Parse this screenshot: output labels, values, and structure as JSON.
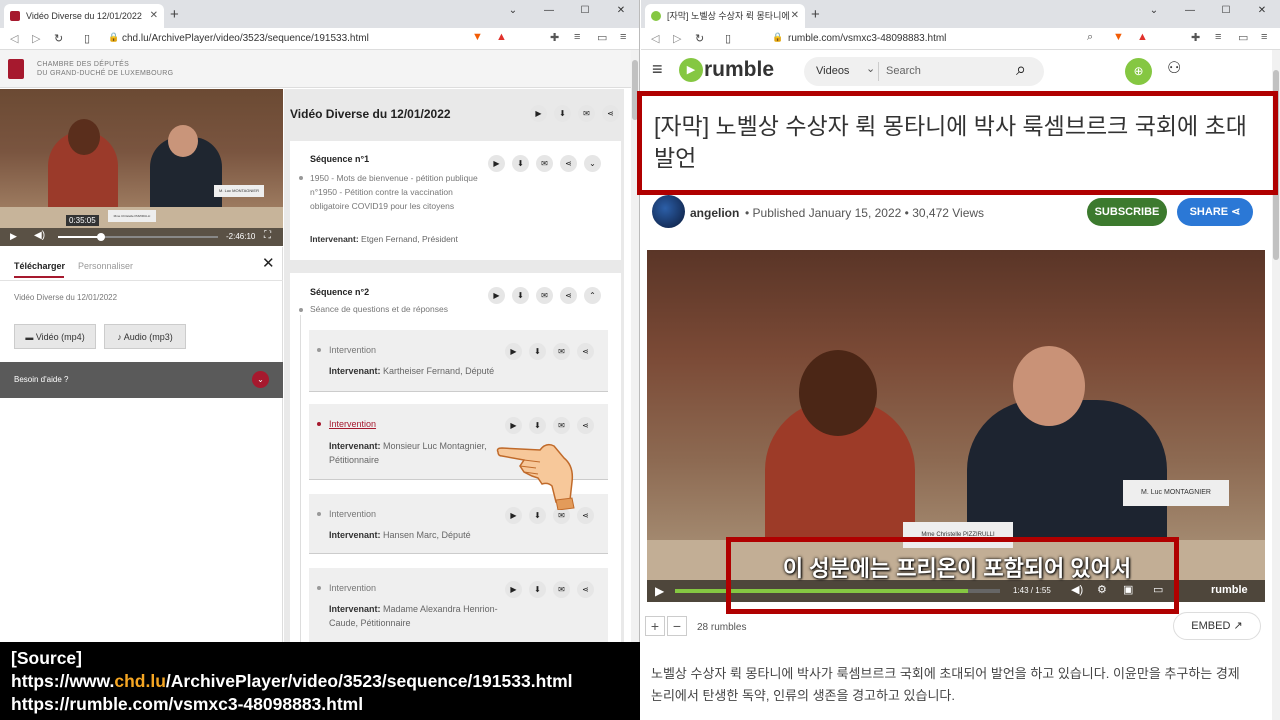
{
  "left_browser": {
    "tab_title": "Vidéo Diverse du 12/01/2022",
    "url": "chd.lu/ArchivePlayer/video/3523/sequence/191533.html",
    "site_header_line1": "CHAMBRE DES DÉPUTÉS",
    "site_header_line2": "DU GRAND-DUCHÉ DE LUXEMBOURG",
    "player": {
      "tooltip_time": "0:35:05",
      "remaining": "-2:46:10",
      "progress_fraction": 0.27,
      "nameplate_1": "Mme Christelle PIZZIRULLI",
      "nameplate_2": "M. Luc MONTAGNIER"
    },
    "download_panel": {
      "tab_active": "Télécharger",
      "tab_inactive": "Personnaliser",
      "video_name": "Vidéo Diverse du 12/01/2022",
      "btn_video": "Vidéo (mp4)",
      "btn_audio": "Audio (mp3)",
      "help": "Besoin d'aide ?"
    },
    "list_title": "Vidéo Diverse du 12/01/2022",
    "sequences": [
      {
        "title": "Séquence n°1",
        "desc": "1950 - Mots de bienvenue - pétition publique n°1950 - Pétition contre la vaccination obligatoire COVID19 pour les citoyens",
        "intervenant_label": "Intervenant:",
        "intervenant": "Etgen Fernand, Président"
      },
      {
        "title": "Séquence n°2",
        "desc": "Séance de questions et de réponses"
      }
    ],
    "interventions": [
      {
        "label": "Intervention",
        "intervenant_label": "Intervenant:",
        "intervenant": "Kartheiser Fernand, Député",
        "active": false
      },
      {
        "label": "Intervention",
        "intervenant_label": "Intervenant:",
        "intervenant": "Monsieur Luc Montagnier, Pétitionnaire",
        "active": true
      },
      {
        "label": "Intervention",
        "intervenant_label": "Intervenant:",
        "intervenant": "Hansen Marc, Député",
        "active": false
      },
      {
        "label": "Intervention",
        "intervenant_label": "Intervenant:",
        "intervenant": "Madame Alexandra Henrion-Caude, Pétitionnaire",
        "active": false
      }
    ]
  },
  "right_browser": {
    "tab_title": "[자막] 노벨상 수상자 뤽 몽타니에",
    "url": "rumble.com/vsmxc3-48098883.html",
    "logo": "rumble",
    "videos_dropdown": "Videos",
    "search_placeholder": "Search",
    "video_title": "[자막] 노벨상 수상자 뤽 몽타니에 박사 룩셈브르크 국회에 초대 발언",
    "channel": "angelion",
    "published": "Published January 15, 2022",
    "views": "30,472 Views",
    "subscribe": "SUBSCRIBE",
    "share": "SHARE",
    "subtitle": "이 성분에는 프리온이 포함되어 있어서",
    "time": "1:43 / 1:55",
    "progress_fraction": 0.9,
    "watermark": "rumble",
    "nameplate_1": "Mme Christelle PIZZIRULLI",
    "nameplate_2": "M. Luc MONTAGNIER",
    "rumbles": "28 rumbles",
    "embed": "EMBED",
    "description": "노벨상 수상자 뤽 몽타니에 박사가 룩셈브르크 국회에 초대되어 발언을 하고 있습니다. 이윤만을 추구하는 경제 논리에서 탄생한 독약, 인류의 생존을 경고하고 있습니다."
  },
  "source_overlay": {
    "heading": "[Source]",
    "line1_prefix": "https://www.",
    "line1_highlight": "chd.lu",
    "line1_suffix": "/ArchivePlayer/video/3523/sequence/191533.html",
    "line2": "https://rumble.com/vsmxc3-48098883.html",
    "highlight_color": "#f5a623"
  },
  "colors": {
    "rumble_green": "#85c742",
    "chd_red": "#a6192e",
    "annotation_red": "#b00000"
  }
}
